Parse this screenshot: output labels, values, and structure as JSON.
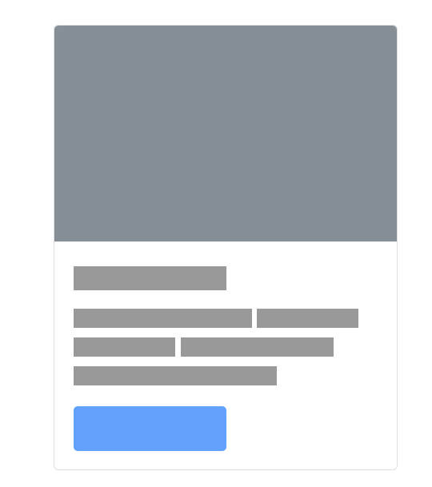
{
  "card": {
    "image": {
      "color": "#868e96"
    },
    "title_placeholder": {
      "color": "#999999"
    },
    "text_placeholders": [
      {
        "line": 1,
        "segment": 1
      },
      {
        "line": 1,
        "segment": 2
      },
      {
        "line": 2,
        "segment": 1
      },
      {
        "line": 2,
        "segment": 2
      },
      {
        "line": 3,
        "segment": 1
      }
    ],
    "button_placeholder": {
      "color": "#62a2fd",
      "label": ""
    },
    "border_color": "#dee0e3"
  }
}
